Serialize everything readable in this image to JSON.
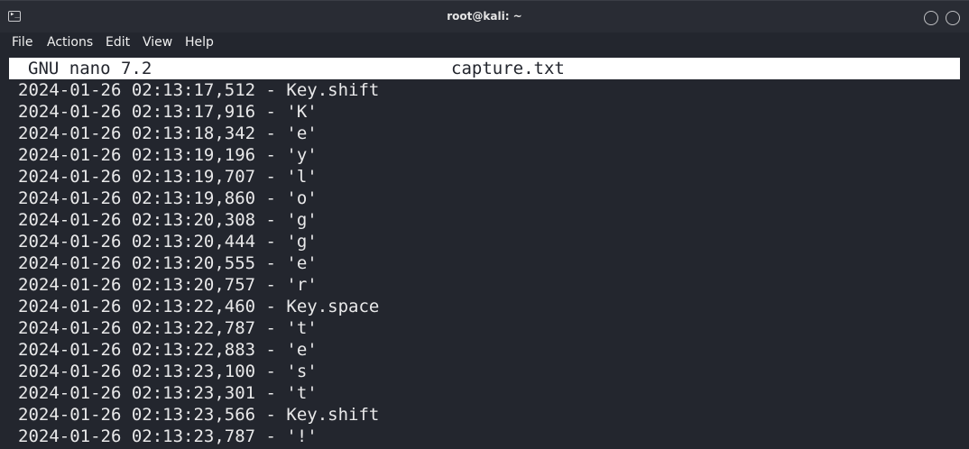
{
  "window": {
    "title": "root@kali: ~"
  },
  "menu": {
    "items": [
      "File",
      "Actions",
      "Edit",
      "View",
      "Help"
    ]
  },
  "nano": {
    "version_label": "GNU nano 7.2",
    "filename": "capture.txt"
  },
  "content": {
    "lines": [
      "2024-01-26 02:13:17,512 - Key.shift",
      "2024-01-26 02:13:17,916 - 'K'",
      "2024-01-26 02:13:18,342 - 'e'",
      "2024-01-26 02:13:19,196 - 'y'",
      "2024-01-26 02:13:19,707 - 'l'",
      "2024-01-26 02:13:19,860 - 'o'",
      "2024-01-26 02:13:20,308 - 'g'",
      "2024-01-26 02:13:20,444 - 'g'",
      "2024-01-26 02:13:20,555 - 'e'",
      "2024-01-26 02:13:20,757 - 'r'",
      "2024-01-26 02:13:22,460 - Key.space",
      "2024-01-26 02:13:22,787 - 't'",
      "2024-01-26 02:13:22,883 - 'e'",
      "2024-01-26 02:13:23,100 - 's'",
      "2024-01-26 02:13:23,301 - 't'",
      "2024-01-26 02:13:23,566 - Key.shift",
      "2024-01-26 02:13:23,787 - '!'"
    ]
  },
  "colors": {
    "background": "#23262e",
    "titlebar": "#292c34",
    "text": "#e9e9ea",
    "header_bg": "#ffffff"
  },
  "icons": {
    "app": "terminal-icon",
    "minimize": "minimize-icon",
    "close": "close-icon"
  }
}
